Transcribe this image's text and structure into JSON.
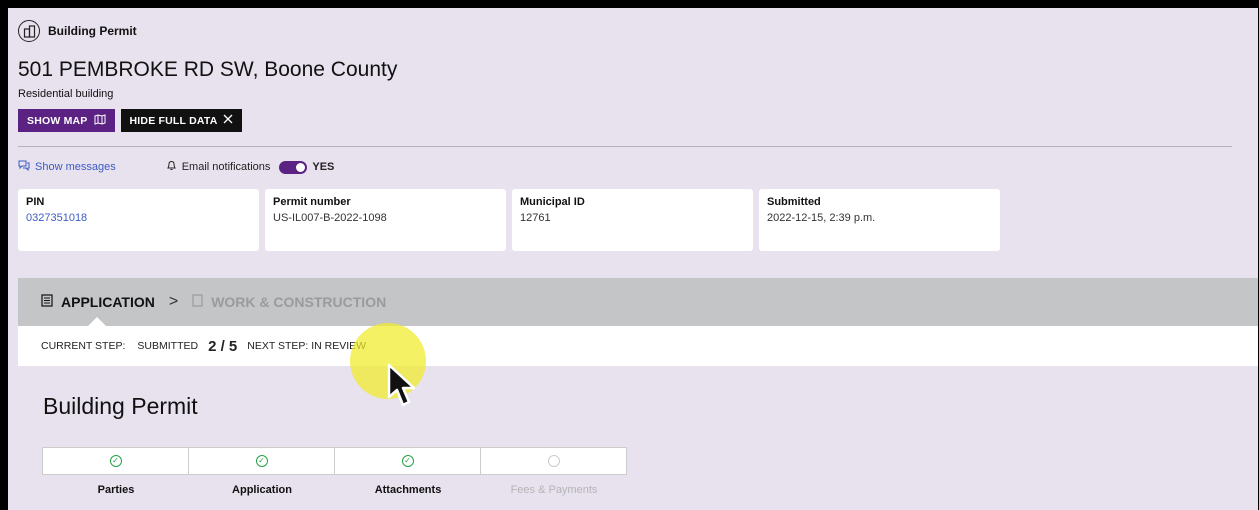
{
  "header": {
    "app_title": "Building Permit",
    "address": "501 PEMBROKE RD SW, Boone County",
    "building_type": "Residential building"
  },
  "buttons": {
    "show_map": "SHOW MAP",
    "hide_full_data": "HIDE FULL DATA"
  },
  "messages": {
    "show_messages": "Show messages",
    "email_notifications": "Email notifications",
    "toggle_state": "YES"
  },
  "info_cards": [
    {
      "label": "PIN",
      "value": "0327351018"
    },
    {
      "label": "Permit number",
      "value": "US-IL007-B-2022-1098"
    },
    {
      "label": "Municipal ID",
      "value": "12761"
    },
    {
      "label": "Submitted",
      "value": "2022-12-15, 2:39 p.m."
    }
  ],
  "stages": {
    "active": "APPLICATION",
    "next": "WORK & CONSTRUCTION"
  },
  "current_step": {
    "label": "CURRENT STEP:",
    "status": "SUBMITTED",
    "count": "2 / 5",
    "next_step": "NEXT STEP: IN REVIEW"
  },
  "section": {
    "title": "Building Permit"
  },
  "progress_steps": [
    {
      "label": "Parties",
      "done": true
    },
    {
      "label": "Application",
      "done": true
    },
    {
      "label": "Attachments",
      "done": true
    },
    {
      "label": "Fees & Payments",
      "done": false
    }
  ],
  "colors": {
    "accent": "#5b2183",
    "link": "#3b5cc4",
    "success": "#27a244",
    "background": "#e8e1ee"
  }
}
